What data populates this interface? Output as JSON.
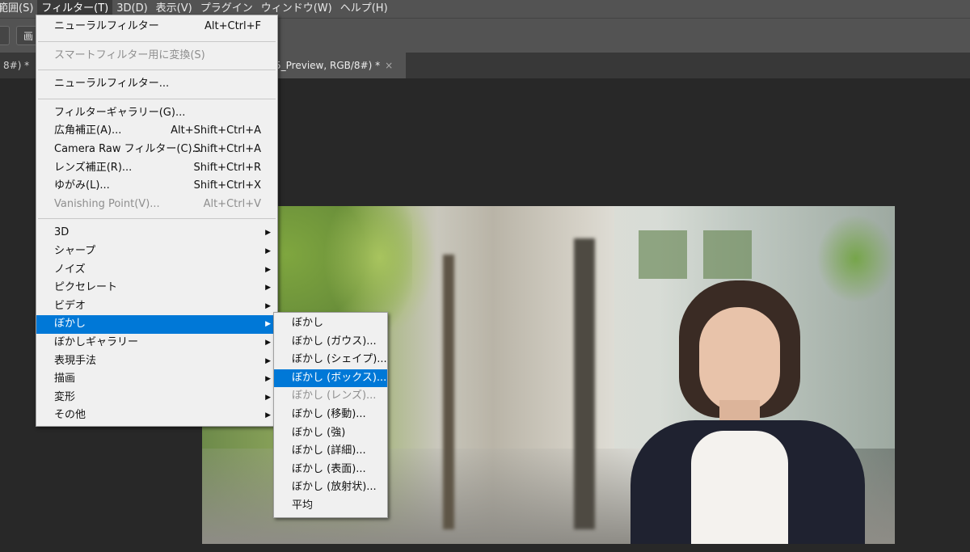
{
  "menubar": {
    "items": [
      {
        "label": "範囲(S)"
      },
      {
        "label": "フィルター(T)"
      },
      {
        "label": "3D(D)"
      },
      {
        "label": "表示(V)"
      },
      {
        "label": "プラグイン"
      },
      {
        "label": "ウィンドウ(W)"
      },
      {
        "label": "ヘルプ(H)"
      }
    ]
  },
  "optionsbar": {
    "button1": "",
    "button2": "画"
  },
  "tabs": [
    {
      "label": "8#) *",
      "close": "×"
    },
    {
      "label": "5_Preview, RGB/8#) *",
      "close": "×"
    }
  ],
  "filter_menu": {
    "items": [
      {
        "label": "ニューラルフィルター",
        "shortcut": "Alt+Ctrl+F"
      },
      {
        "label": "スマートフィルター用に変換(S)",
        "shortcut": "",
        "disabled": true
      },
      {
        "label": "ニューラルフィルター...",
        "shortcut": ""
      },
      {
        "label": "フィルターギャラリー(G)...",
        "shortcut": ""
      },
      {
        "label": "広角補正(A)...",
        "shortcut": "Alt+Shift+Ctrl+A"
      },
      {
        "label": "Camera Raw フィルター(C)...",
        "shortcut": "Shift+Ctrl+A"
      },
      {
        "label": "レンズ補正(R)...",
        "shortcut": "Shift+Ctrl+R"
      },
      {
        "label": "ゆがみ(L)...",
        "shortcut": "Shift+Ctrl+X"
      },
      {
        "label": "Vanishing Point(V)...",
        "shortcut": "Alt+Ctrl+V",
        "disabled": true
      },
      {
        "label": "3D"
      },
      {
        "label": "シャープ"
      },
      {
        "label": "ノイズ"
      },
      {
        "label": "ピクセレート"
      },
      {
        "label": "ビデオ"
      },
      {
        "label": "ぼかし"
      },
      {
        "label": "ぼかしギャラリー"
      },
      {
        "label": "表現手法"
      },
      {
        "label": "描画"
      },
      {
        "label": "変形"
      },
      {
        "label": "その他"
      }
    ]
  },
  "blur_submenu": {
    "items": [
      {
        "label": "ぼかし"
      },
      {
        "label": "ぼかし (ガウス)..."
      },
      {
        "label": "ぼかし (シェイプ)..."
      },
      {
        "label": "ぼかし (ボックス)..."
      },
      {
        "label": "ぼかし (レンズ)..."
      },
      {
        "label": "ぼかし (移動)..."
      },
      {
        "label": "ぼかし (強)"
      },
      {
        "label": "ぼかし (詳細)..."
      },
      {
        "label": "ぼかし (表面)..."
      },
      {
        "label": "ぼかし (放射状)..."
      },
      {
        "label": "平均"
      }
    ]
  },
  "colors": {
    "highlight": "#0078d7",
    "menu_bg": "#f0f0f0",
    "app_bg": "#282828"
  }
}
